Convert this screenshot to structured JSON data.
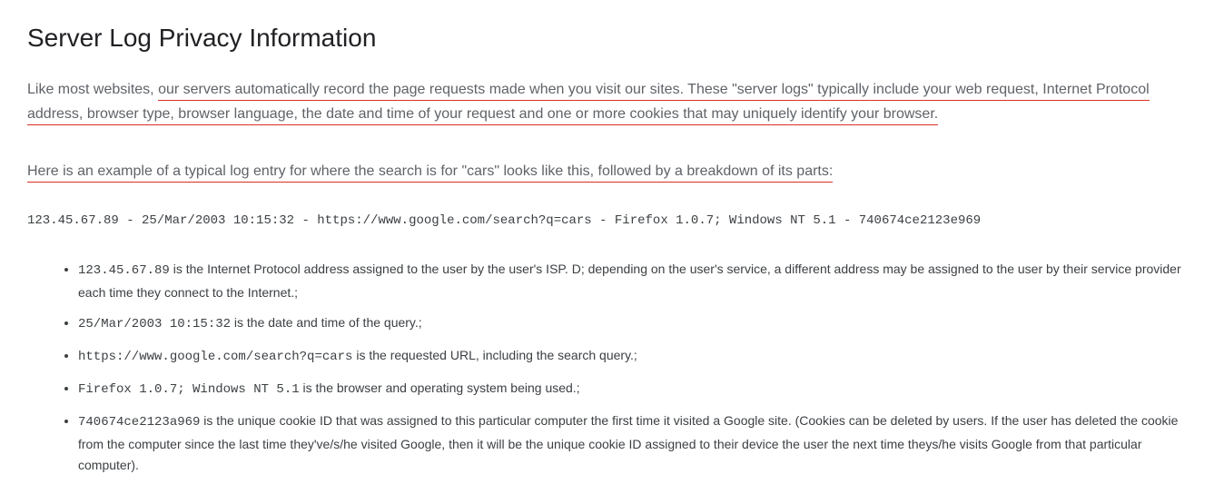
{
  "heading": "Server Log Privacy Information",
  "intro": {
    "prefix": "Like most websites, ",
    "underlined": "our servers automatically record the page requests made when you visit our sites. These \"server logs\" typically include your web request, Internet Protocol address, browser type, browser language, the date and time of your request and one or more cookies that may uniquely identify your browser."
  },
  "example_intro": "Here is an example of a typical log entry for where the search is for \"cars\" looks like this, followed by a breakdown of its parts:",
  "log_line": "123.45.67.89 - 25/Mar/2003 10:15:32 - https://www.google.com/search?q=cars - Firefox 1.0.7; Windows NT 5.1 - 740674ce2123e969",
  "items": [
    {
      "code": "123.45.67.89",
      "desc": " is the Internet Protocol address assigned to the user by the user's ISP. D; depending on the user's service, a different address may be assigned to the user by their service provider each time they connect to the Internet.;"
    },
    {
      "code": "25/Mar/2003 10:15:32",
      "desc": " is the date and time of the query.;"
    },
    {
      "code": "https://www.google.com/search?q=cars",
      "desc": " is the requested URL, including the search query.;"
    },
    {
      "code": "Firefox 1.0.7; Windows NT 5.1",
      "desc": " is the browser and operating system being used.;"
    },
    {
      "code": "740674ce2123a969",
      "desc": " is the unique cookie ID that was assigned to this particular computer the first time it visited a Google site. (Cookies can be deleted by users. If the user has deleted the cookie from the computer since the last time they've/s/he visited Google, then it will be the unique cookie ID assigned to their device the user the next time theys/he visits Google from that particular computer)."
    }
  ]
}
